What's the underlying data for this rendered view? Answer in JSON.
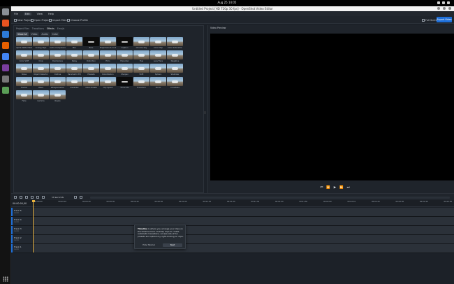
{
  "system_bar": {
    "clock": "Aug 25  14:05",
    "tray_icons": [
      "network-icon",
      "volume-icon",
      "power-icon"
    ]
  },
  "dock": {
    "apps": [
      {
        "name": "files-app-icon",
        "color": "#8a8f95"
      },
      {
        "name": "software-center-icon",
        "color": "#e95420"
      },
      {
        "name": "help-icon",
        "color": "#2d7ad6"
      },
      {
        "name": "firefox-icon",
        "color": "#e66000"
      },
      {
        "name": "chrome-icon",
        "color": "#4285f4"
      },
      {
        "name": "shotcut-icon",
        "color": "#7a3e9d"
      },
      {
        "name": "settings-icon",
        "color": "#777777"
      },
      {
        "name": "trash-icon",
        "color": "#5a9e56"
      }
    ]
  },
  "window": {
    "title": "Untitled Project [HD 720p 30 fps] - OpenShot Video Editor"
  },
  "menu": [
    "File",
    "Edit",
    "View",
    "Help"
  ],
  "toolbar": {
    "buttons": [
      "New Project",
      "Open Project",
      "Import Files",
      "Choose Profile"
    ],
    "right_buttons": [
      "Full Screen"
    ],
    "export_label": "Export Video"
  },
  "left_panel": {
    "tabs": [
      "Project Files",
      "Transitions",
      "Effects",
      "Emojis"
    ],
    "active_tab": "Effects",
    "filters": [
      "Show All",
      "Video",
      "Audio",
      "Color"
    ],
    "active_filter": "Show All",
    "effects": [
      "Alpha Matte Mask",
      "Analog Tape",
      "Audio Compressor",
      "Blur",
      "Bars",
      "Brightness & Contrast",
      "Caption",
      "Chroma Key",
      "Color Map",
      "Color Saturation",
      "Color Shift",
      "Crop",
      "Deinterlace",
      "Delay",
      "Distortion",
      "Echo",
      "Expander",
      "Hue",
      "Lens Flare",
      "Negative",
      "Noise",
      "Object Detector",
      "Outline",
      "Parametric EQ",
      "Pixelate",
      "Robotization",
      "Sharpen",
      "Shift",
      "Sphere",
      "Stabilizer",
      "Tracker",
      "Wave",
      "Whisperization",
      "Visualizer",
      "Video Rotate",
      "Clip Speed",
      "Timecode",
      "Transform",
      "Zoom",
      "Crossfade",
      "Fade",
      "Gamma",
      "Ripple"
    ]
  },
  "preview_panel": {
    "title": "Video Preview",
    "controls": [
      "⏮",
      "⏪",
      "▶",
      "⏩",
      "⏭"
    ]
  },
  "timeline": {
    "timecode": "00:00:00,00",
    "zoom_label": "10 seconds",
    "ticks": [
      "00:00:00",
      "00:00:10",
      "00:00:20",
      "00:00:30",
      "00:00:40",
      "00:00:50",
      "00:01:00",
      "00:01:10",
      "00:01:20",
      "00:01:30",
      "00:01:40",
      "00:01:50",
      "00:02:00",
      "00:02:10",
      "00:02:20",
      "00:02:30",
      "00:02:40",
      "00:02:50"
    ],
    "tracks": [
      {
        "name": "Track 5",
        "sub": "Audio"
      },
      {
        "name": "Track 4",
        "sub": "Audio"
      },
      {
        "name": "Track 3",
        "sub": "Audio"
      },
      {
        "name": "Track 2",
        "sub": "Audio"
      },
      {
        "name": "Track 1",
        "sub": "Audio"
      }
    ]
  },
  "tour_popup": {
    "title": "Timeline",
    "body": " is where you arrange your clips on the timeline here. Overlap clips to create automatic transitions. Access lots of fun presets and options by right-clicking on clips.",
    "hide_label": "Hide Tutorial",
    "next_label": "Next"
  }
}
